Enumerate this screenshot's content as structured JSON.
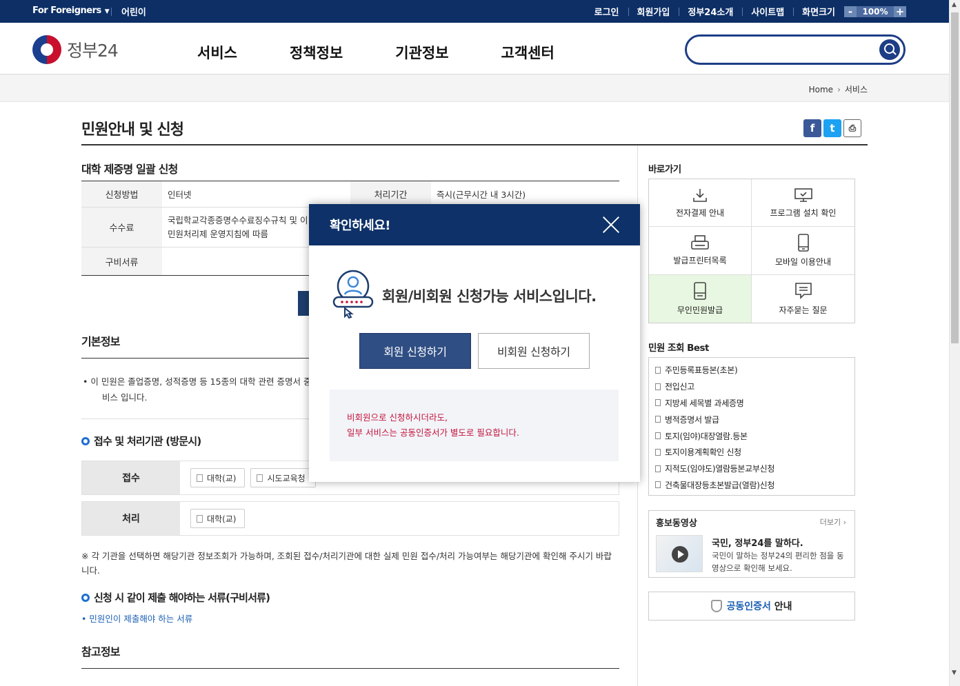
{
  "topbar": {
    "for_foreigners": "For Foreigners",
    "kids": "어린이",
    "login": "로그인",
    "signup": "회원가입",
    "about": "정부24소개",
    "sitemap": "사이트맵",
    "screen_size": "화면크기",
    "zoom_minus": "-",
    "zoom_value": "100%",
    "zoom_plus": "+"
  },
  "header": {
    "logo_text": "정부24",
    "nav": [
      "서비스",
      "정책정보",
      "기관정보",
      "고객센터"
    ],
    "search_placeholder": ""
  },
  "breadcrumb": {
    "home": "Home",
    "current": "서비스"
  },
  "page": {
    "title": "민원안내 및 신청",
    "service_title": "대학 제증명 일괄 신청",
    "table": {
      "method_label": "신청방법",
      "method_value": "인터넷",
      "period_label": "처리기간",
      "period_value": "즉시(근무시간 내 3시간)",
      "fee_label": "수수료",
      "fee_line1": "국립학교각종증명수수료징수규칙 및 이",
      "fee_line2": "민원처리제 운영지침에 따름",
      "docs_label": "구비서류",
      "docs_value": ""
    },
    "basic_info_title": "기본정보",
    "basic_info_line1": "• 이 민원은 졸업증명, 성적증명 등 15종의 대학 관련 증명서 중",
    "basic_info_line2": "비스 입니다.",
    "orgs_title": "접수 및 처리기관 (방문시)",
    "receive_label": "접수",
    "receive_chips": [
      "대학(교)",
      "시도교육청"
    ],
    "process_label": "처리",
    "process_chips": [
      "대학(교)"
    ],
    "note_text": "※ 각 기관을 선택하면 해당기관 정보조회가 가능하며, 조회된 접수/처리기관에 대한 실제 민원 접수/처리 가능여부는 해당기관에 확인해 주시기 바랍니다.",
    "docs_title": "신청 시 같이 제출 해야하는 서류(구비서류)",
    "docs_link": "• 민원인이 제출해야 하는 서류",
    "ref_title": "참고정보"
  },
  "sidebar": {
    "quick_title": "바로가기",
    "quick_items": [
      {
        "label": "전자결제 안내",
        "icon": "download-icon"
      },
      {
        "label": "프로그램 설치 확인",
        "icon": "monitor-icon"
      },
      {
        "label": "발급프린터목록",
        "icon": "printer-icon"
      },
      {
        "label": "모바일 이용안내",
        "icon": "mobile-icon"
      },
      {
        "label": "무인민원발급",
        "icon": "kiosk-icon"
      },
      {
        "label": "자주묻는 질문",
        "icon": "chat-icon"
      }
    ],
    "best_title": "민원 조회 Best",
    "best_items": [
      "주민등록표등본(초본)",
      "전입신고",
      "지방세 세목별 과세증명",
      "병적증명서 발급",
      "토지(임야)대장열람.등본",
      "토지이용계획확인 신청",
      "지적도(임야도)열람등본교부신청",
      "건축물대장등초본발급(열람)신청"
    ],
    "promo_title": "홍보동영상",
    "promo_more": "더보기 ›",
    "promo_headline": "국민, 정부24를 말하다.",
    "promo_desc": "국민이 말하는 정부24의 편리한 점을 동영상으로 확인해 보세요.",
    "cert_blue": "공동인증서",
    "cert_rest": "안내"
  },
  "modal": {
    "title": "확인하세요!",
    "message": "회원/비회원 신청가능 서비스입니다.",
    "member_button": "회원 신청하기",
    "guest_button": "비회원 신청하기",
    "notice_line1": "비회원으로 신청하시더라도,",
    "notice_line2": "일부 서비스는 공동인증서가 별도로 필요합니다."
  },
  "colors": {
    "topbar_bg": "#0d2f66",
    "modal_header": "#0d3168",
    "member_button": "#2f4e84",
    "notice_text": "#c4143c",
    "active_quick": "#e8f7e1"
  }
}
